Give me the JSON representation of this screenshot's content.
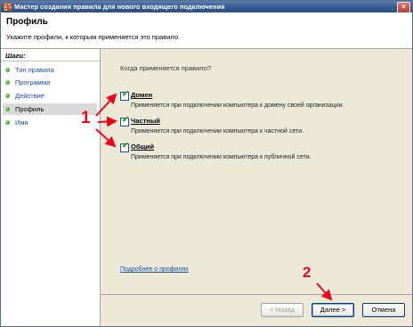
{
  "window": {
    "title": "Мастер создания правила для нового входящего подключения",
    "close_glyph": "×"
  },
  "header": {
    "title": "Профиль",
    "subtitle": "Укажите профили, к которым применяется это правило."
  },
  "sidebar": {
    "title": "Шаги:",
    "items": [
      {
        "label": "Тип правила",
        "active": false
      },
      {
        "label": "Программа",
        "active": false
      },
      {
        "label": "Действие",
        "active": false
      },
      {
        "label": "Профиль",
        "active": true
      },
      {
        "label": "Имя",
        "active": false
      }
    ]
  },
  "main": {
    "question": "Когда применяется правило?",
    "options": [
      {
        "label": "Домен",
        "description": "Применяется при подключении компьютера к домену своей организации.",
        "checked": true
      },
      {
        "label": "Частный",
        "description": "Применяется при подключении компьютера к частной сети.",
        "checked": true
      },
      {
        "label": "Общий",
        "description": "Применяется при подключении компьютера к публичной сети.",
        "checked": true
      }
    ],
    "learn_more": "Подробнее о профилях"
  },
  "buttons": {
    "back": "< Назад",
    "next": "Далее >",
    "cancel": "Отмена"
  },
  "annotations": {
    "marker_1": "1",
    "marker_2": "2",
    "color": "#e8061a"
  },
  "icons": {
    "checkbox": "check-icon",
    "step": "green-dot-icon"
  }
}
